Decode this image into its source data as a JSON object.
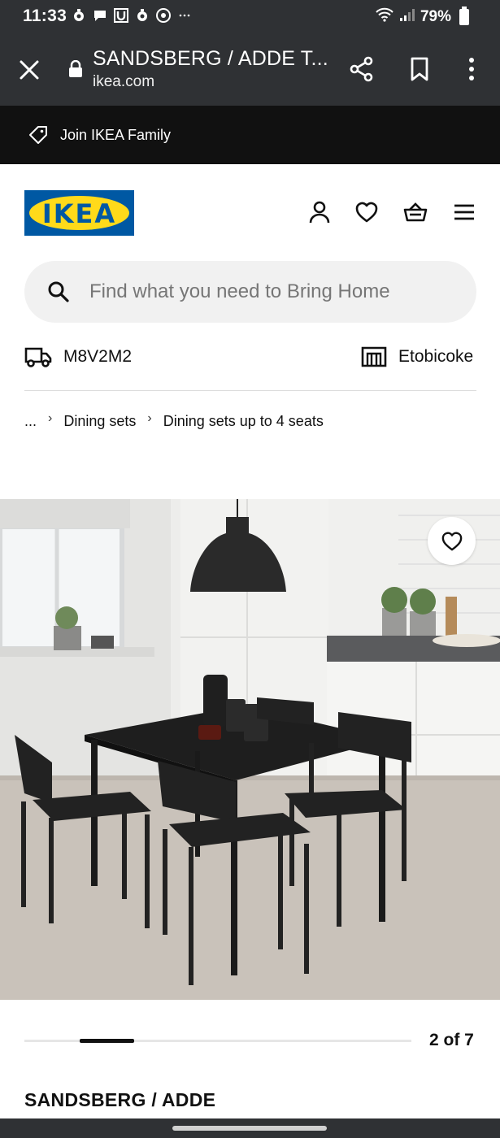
{
  "status_bar": {
    "time": "11:33",
    "battery": "79%"
  },
  "browser": {
    "title": "SANDSBERG / ADDE T...",
    "domain": "ikea.com"
  },
  "family_banner": {
    "label": "Join IKEA Family"
  },
  "header": {
    "logo_text": "IKEA"
  },
  "search": {
    "placeholder": "Find what you need to Bring Home"
  },
  "location": {
    "postal_code": "M8V2M2",
    "store": "Etobicoke"
  },
  "breadcrumb": {
    "ellipsis": "...",
    "items": [
      "Dining sets",
      "Dining sets up to 4 seats"
    ]
  },
  "gallery": {
    "counter": "2 of 7"
  },
  "product": {
    "name": "SANDSBERG / ADDE"
  },
  "colors": {
    "status_bg": "#2f3134",
    "banner_bg": "#111111",
    "ikea_blue": "#0058a3",
    "ikea_yellow": "#ffda1a"
  }
}
